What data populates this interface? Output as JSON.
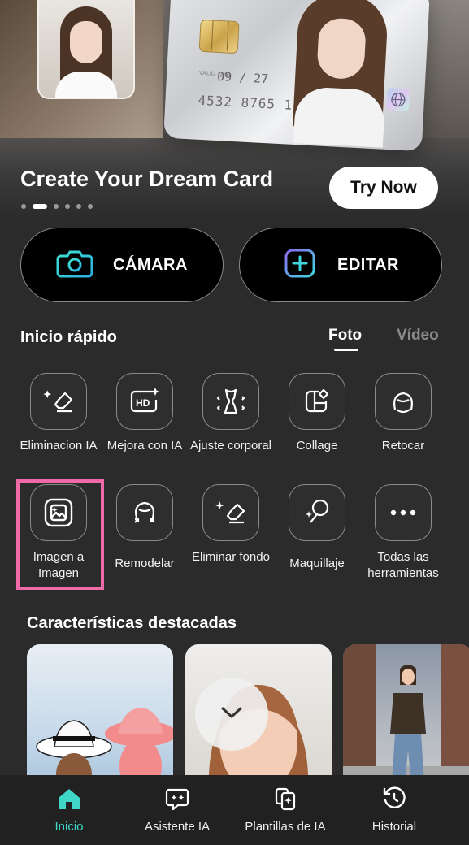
{
  "hero": {
    "title": "Create Your Dream Card",
    "cta": "Try Now",
    "card": {
      "valid_label": "VALID THRU",
      "expiry": "09 / 27",
      "number": "4532 8765 1098 4321"
    },
    "carousel_pages": 6,
    "carousel_active": 1
  },
  "actions": {
    "camera": "CÁMARA",
    "edit": "EDITAR"
  },
  "quick_start": {
    "title": "Inicio rápido",
    "tabs": [
      "Foto",
      "Vídeo"
    ],
    "active_tab": "Foto",
    "tools": [
      {
        "label": "Eliminacion IA",
        "icon": "eraser-sparkle-icon"
      },
      {
        "label": "Mejora con IA",
        "icon": "hd-sparkle-icon"
      },
      {
        "label": "Ajuste corporal",
        "icon": "body-shape-icon"
      },
      {
        "label": "Collage",
        "icon": "collage-icon"
      },
      {
        "label": "Retocar",
        "icon": "face-retouch-icon"
      },
      {
        "label": "Imagen a Imagen",
        "icon": "image-sparkle-icon"
      },
      {
        "label": "Remodelar",
        "icon": "face-reshape-icon"
      },
      {
        "label": "Eliminar fondo",
        "icon": "eraser-sparkle-icon"
      },
      {
        "label": "Maquillaje",
        "icon": "makeup-mirror-icon"
      },
      {
        "label": "Todas las herramientas",
        "icon": "more-dots-icon"
      }
    ],
    "highlighted_tool": "Imagen a Imagen"
  },
  "featured": {
    "title": "Características destacadas"
  },
  "bottom_nav": {
    "items": [
      {
        "label": "Inicio",
        "icon": "home-icon"
      },
      {
        "label": "Asistente IA",
        "icon": "ai-assistant-icon"
      },
      {
        "label": "Plantillas de IA",
        "icon": "templates-icon"
      },
      {
        "label": "Historial",
        "icon": "history-icon"
      }
    ],
    "active": "Inicio"
  },
  "colors": {
    "background": "#2b2b2b",
    "accent_teal": "#3fd6c8",
    "highlight_pink": "#f16aa8",
    "nav_background": "#212121"
  }
}
